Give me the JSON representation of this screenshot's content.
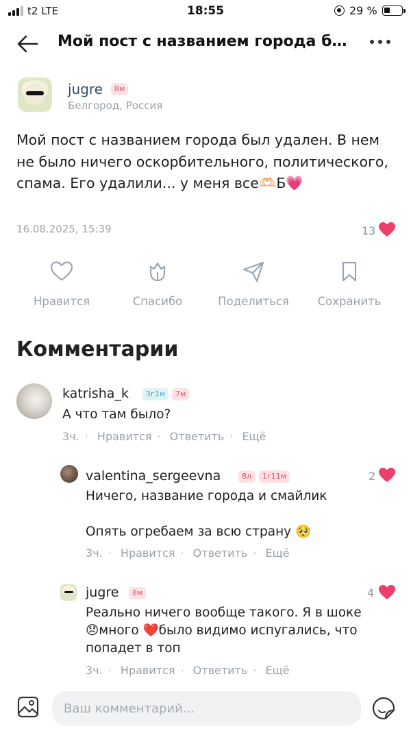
{
  "status_bar": {
    "carrier": "t2  LTE",
    "time": "18:55",
    "battery": "29 %"
  },
  "header": {
    "title": "Мой пост с названием города бы..."
  },
  "post": {
    "author": "jugre",
    "badge": "8м",
    "location": "Белгород, Россия",
    "text": "Мой пост с названием города был удален. В нем не было ничего оскорбительного, политического, спама. Его удалили... у меня все🫶🏻Б💗",
    "date": "16.08.2025, 15:39",
    "likes": "13"
  },
  "actions": [
    {
      "label": "Нравится",
      "icon": "heart-outline-icon"
    },
    {
      "label": "Спасибо",
      "icon": "flower-icon"
    },
    {
      "label": "Поделиться",
      "icon": "paper-plane-icon"
    },
    {
      "label": "Сохранить",
      "icon": "bookmark-icon"
    }
  ],
  "comments_title": "Комментарии",
  "comments": [
    {
      "author": "katrisha_k",
      "badges": [
        "3г1м",
        "7м"
      ],
      "text": "А что там было?",
      "meta": {
        "time": "3ч.",
        "like": "Нравится",
        "reply": "Ответить",
        "more": "Ещё"
      }
    },
    {
      "author": "valentina_sergeevna",
      "badges": [
        "8л",
        "1г11м"
      ],
      "text_line1": "Ничего, название города и смайлик",
      "text_line2": "Опять огребаем за всю страну 🥺",
      "likes": "2",
      "meta": {
        "time": "3ч.",
        "like": "Нравится",
        "reply": "Ответить",
        "more": "Ещё"
      }
    },
    {
      "author": "jugre",
      "badges": [
        "8м"
      ],
      "text_line1": "Реально ничего вообще такого. Я в шоке",
      "text_line2": "😞много ❤️было видимо испугались, что",
      "text_line3": "попадет в топ",
      "likes": "4",
      "meta": {
        "time": "3ч.",
        "like": "Нравится",
        "reply": "Ответить",
        "more": "Ещё"
      }
    }
  ],
  "input": {
    "placeholder": "Ваш комментарий..."
  },
  "colors": {
    "heart": "#ee3e6b",
    "link_name": "#2f4f66",
    "muted": "#9aa1a8"
  }
}
